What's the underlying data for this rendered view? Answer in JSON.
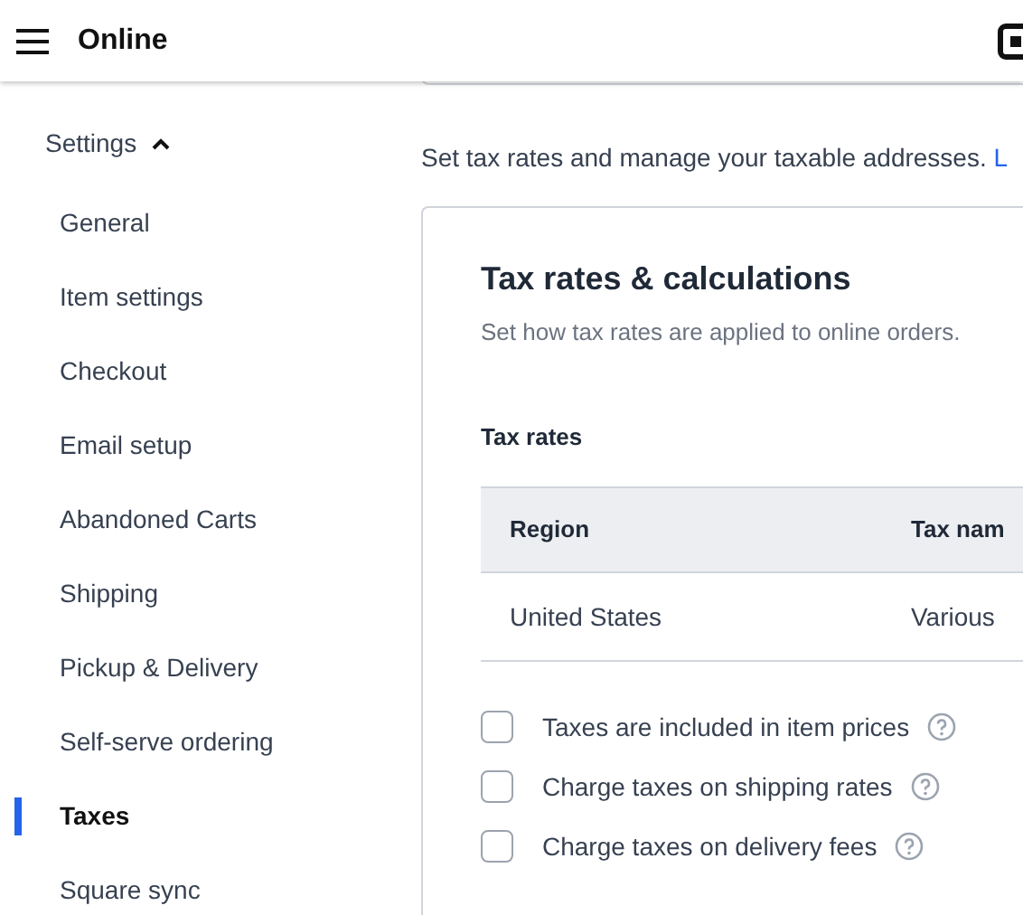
{
  "header": {
    "title": "Online"
  },
  "sidebar": {
    "section": {
      "label": "Settings",
      "expanded": true
    },
    "items": [
      {
        "label": "General",
        "selected": false
      },
      {
        "label": "Item settings",
        "selected": false
      },
      {
        "label": "Checkout",
        "selected": false
      },
      {
        "label": "Email setup",
        "selected": false
      },
      {
        "label": "Abandoned Carts",
        "selected": false
      },
      {
        "label": "Shipping",
        "selected": false
      },
      {
        "label": "Pickup & Delivery",
        "selected": false
      },
      {
        "label": "Self-serve ordering",
        "selected": false
      },
      {
        "label": "Taxes",
        "selected": true
      },
      {
        "label": "Square sync",
        "selected": false
      }
    ]
  },
  "intro": {
    "text": "Set tax rates and manage your taxable addresses.",
    "link": "L"
  },
  "card": {
    "title": "Tax rates & calculations",
    "subtitle": "Set how tax rates are applied to online orders.",
    "section": "Tax rates",
    "table": {
      "columns": [
        "Region",
        "Tax nam"
      ],
      "rows": [
        [
          "United States",
          "Various"
        ]
      ]
    },
    "options": [
      {
        "label": "Taxes are included in item prices",
        "checked": false
      },
      {
        "label": "Charge taxes on shipping rates",
        "checked": false
      },
      {
        "label": "Charge taxes on delivery fees",
        "checked": false
      }
    ]
  }
}
